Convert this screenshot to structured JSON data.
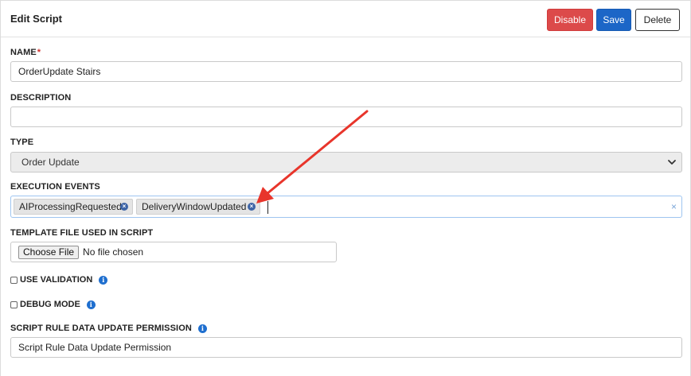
{
  "header": {
    "title": "Edit Script",
    "disable_label": "Disable",
    "save_label": "Save",
    "delete_label": "Delete"
  },
  "form": {
    "name": {
      "label": "NAME",
      "required_mark": "*",
      "value": "OrderUpdate Stairs"
    },
    "description": {
      "label": "DESCRIPTION",
      "value": ""
    },
    "type": {
      "label": "TYPE",
      "selected": "Order Update"
    },
    "execution_events": {
      "label": "EXECUTION EVENTS",
      "tags": [
        "AIProcessingRequested",
        "DeliveryWindowUpdated"
      ],
      "tag_remove_glyph": "×",
      "clear_glyph": "×"
    },
    "template_file": {
      "label": "TEMPLATE FILE USED IN SCRIPT",
      "button_label": "Choose File",
      "status": "No file chosen"
    },
    "use_validation": {
      "label": "USE VALIDATION",
      "checked": false,
      "info_glyph": "i"
    },
    "debug_mode": {
      "label": "DEBUG MODE",
      "checked": false,
      "info_glyph": "i"
    },
    "permission": {
      "label": "SCRIPT RULE DATA UPDATE PERMISSION",
      "info_glyph": "i",
      "value": "Script Rule Data Update Permission"
    }
  },
  "colors": {
    "disable": "#dc4a4a",
    "save": "#1c66c7",
    "annotation_arrow": "#e8352b",
    "info": "#1f6fcf"
  }
}
